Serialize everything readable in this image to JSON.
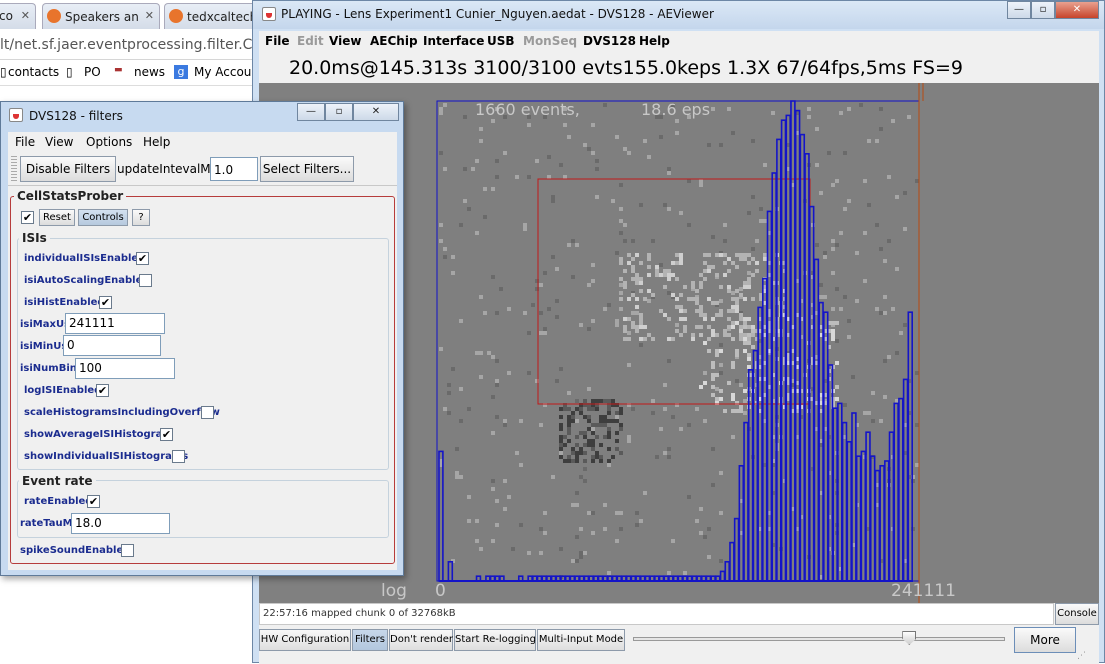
{
  "browser": {
    "tabs": [
      {
        "label": "co"
      },
      {
        "label": "Speakers an"
      },
      {
        "label": "tedxcaltech."
      }
    ],
    "url": "lt/net.sf.jaer.eventprocessing.filter.Cell",
    "bookmarks": [
      "contacts",
      "PO",
      "news",
      "My Accoun"
    ]
  },
  "viewer": {
    "title": "PLAYING - Lens Experiment1 Cunier_Nguyen.aedat - DVS128 - AEViewer",
    "menu": [
      {
        "label": "File",
        "enabled": true
      },
      {
        "label": "Edit",
        "enabled": false
      },
      {
        "label": "View",
        "enabled": true
      },
      {
        "label": "AEChip",
        "enabled": true
      },
      {
        "label": "Interface",
        "enabled": true
      },
      {
        "label": "USB",
        "enabled": true
      },
      {
        "label": "MonSeq",
        "enabled": false
      },
      {
        "label": "DVS128",
        "enabled": true
      },
      {
        "label": "Help",
        "enabled": true
      }
    ],
    "status": "20.0ms@145.313s  3100/3100 evts155.0keps  1.3X  67/64fps,5ms FS=9",
    "overlay": {
      "events": "1660 events,",
      "eps": "18.6  eps"
    },
    "histogram": {
      "axis_left": "log",
      "axis_min": "0",
      "axis_max": "241111"
    },
    "footer_status": "22:57:16 mapped chunk 0 of 32768kB",
    "console_label": "Console",
    "buttons": [
      "HW Configuration",
      "Filters",
      "Don't render",
      "Start Re-logging",
      "Multi-Input Mode"
    ],
    "more_label": "More",
    "slider_value": 0.74
  },
  "filters": {
    "title": "DVS128 - filters",
    "menu": [
      "File",
      "View",
      "Options",
      "Help"
    ],
    "disable_label": "Disable Filters",
    "update_label": "updateIntevalMs",
    "update_value": "1.0",
    "select_label": "Select Filters...",
    "cellstats_title": "CellStatsProber",
    "reset_label": "Reset",
    "controls_label": "Controls",
    "help_label": "?",
    "isis_title": "ISIs",
    "props": {
      "individualISIsEnabled": "individualISIsEnabled",
      "isiAutoScalingEnabled": "isiAutoScalingEnabled",
      "isiHistEnabled": "isiHistEnabled",
      "isiMaxUs": "isiMaxUs",
      "isiMaxUs_value": "241111",
      "isiMinUs": "isiMinUs",
      "isiMinUs_value": "0",
      "isiNumBins": "isiNumBins",
      "isiNumBins_value": "100",
      "logISIEnabled": "logISIEnabled",
      "scaleHistogramsIncludingOverflow": "scaleHistogramsIncludingOverflow",
      "showAverageISIHistogram": "showAverageISIHistogram",
      "showIndividualISIHistograms": "showIndividualISIHistograms",
      "eventrate_title": "Event rate",
      "rateEnabled": "rateEnabled",
      "rateTauMs": "rateTauMs",
      "rateTauMs_value": "18.0",
      "spikeSoundEnabled": "spikeSoundEnabled"
    }
  },
  "chart_data": {
    "type": "bar",
    "bins": 100,
    "x_range": [
      0,
      241111
    ],
    "values": [
      0.27,
      0,
      0.04,
      0,
      0,
      0,
      0,
      0,
      0.01,
      0,
      0.01,
      0.01,
      0.01,
      0.01,
      0,
      0,
      0,
      0.01,
      0,
      0.01,
      0.01,
      0.01,
      0.01,
      0.01,
      0.01,
      0.01,
      0.01,
      0.01,
      0.01,
      0.01,
      0.01,
      0.01,
      0.01,
      0.01,
      0.01,
      0.01,
      0.01,
      0.01,
      0.01,
      0.01,
      0.01,
      0.01,
      0.01,
      0.01,
      0.01,
      0.01,
      0.01,
      0.01,
      0.01,
      0.01,
      0.01,
      0.01,
      0.01,
      0.01,
      0.01,
      0.01,
      0.01,
      0.01,
      0.01,
      0.01,
      0.02,
      0.04,
      0.08,
      0.13,
      0.24,
      0.33,
      0.44,
      0.48,
      0.57,
      0.63,
      0.77,
      0.85,
      0.92,
      0.96,
      0.97,
      1.0,
      0.98,
      0.93,
      0.89,
      0.78,
      0.67,
      0.58,
      0.56,
      0.45,
      0.36,
      0.37,
      0.33,
      0.29,
      0.35,
      0.26,
      0.27,
      0.31,
      0.26,
      0.23,
      0.24,
      0.25,
      0.31,
      0.37,
      0.38,
      0.42,
      0.56
    ]
  }
}
